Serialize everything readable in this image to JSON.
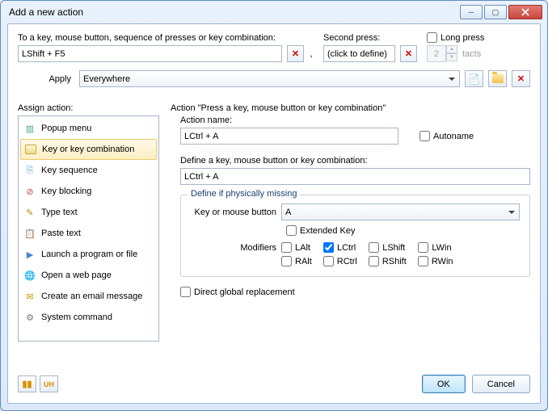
{
  "window": {
    "title": "Add a new action"
  },
  "top": {
    "key_label": "To a key, mouse button, sequence of presses or key combination:",
    "key_value": "LShift + F5",
    "second_press_label": "Second press:",
    "second_press_value": "(click to define)",
    "long_press_label": "Long press",
    "tacts_value": "2",
    "tacts_suffix": "tacts",
    "comma": ","
  },
  "apply": {
    "label": "Apply",
    "value": "Everywhere"
  },
  "assign": {
    "label": "Assign action:",
    "items": [
      {
        "label": "Popup menu",
        "icon": "popup"
      },
      {
        "label": "Key or key combination",
        "icon": "key",
        "selected": true
      },
      {
        "label": "Key sequence",
        "icon": "seq"
      },
      {
        "label": "Key blocking",
        "icon": "block"
      },
      {
        "label": "Type text",
        "icon": "type"
      },
      {
        "label": "Paste text",
        "icon": "paste"
      },
      {
        "label": "Launch a program or file",
        "icon": "launch"
      },
      {
        "label": "Open a web page",
        "icon": "web"
      },
      {
        "label": "Create an email message",
        "icon": "email"
      },
      {
        "label": "System command",
        "icon": "system"
      }
    ]
  },
  "action": {
    "heading": "Action \"Press a key, mouse button or key combination\"",
    "name_label": "Action name:",
    "name_value": "LCtrl + A",
    "autoname_label": "Autoname",
    "define_label": "Define a key, mouse button or key combination:",
    "define_value": "LCtrl + A",
    "missing_legend": "Define if physically missing",
    "key_or_mouse_label": "Key or mouse button",
    "key_or_mouse_value": "A",
    "extended_label": "Extended Key",
    "modifiers_label": "Modifiers",
    "mods": {
      "LAlt": "LAlt",
      "LCtrl": "LCtrl",
      "LShift": "LShift",
      "LWin": "LWin",
      "RAlt": "RAlt",
      "RCtrl": "RCtrl",
      "RShift": "RShift",
      "RWin": "RWin"
    },
    "direct_global_label": "Direct global replacement"
  },
  "buttons": {
    "ok": "OK",
    "cancel": "Cancel"
  }
}
